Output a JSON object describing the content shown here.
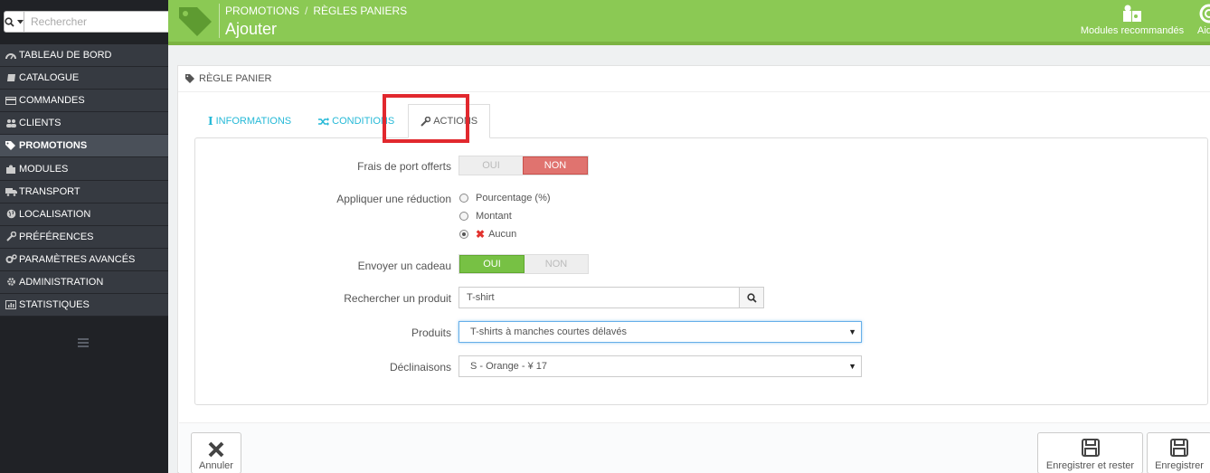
{
  "search": {
    "placeholder": "Rechercher"
  },
  "sidebar": {
    "items": [
      {
        "label": "TABLEAU DE BORD",
        "icon": "dashboard-icon"
      },
      {
        "label": "CATALOGUE",
        "icon": "book-icon"
      },
      {
        "label": "COMMANDES",
        "icon": "credit-card-icon"
      },
      {
        "label": "CLIENTS",
        "icon": "users-icon"
      },
      {
        "label": "PROMOTIONS",
        "icon": "tags-icon",
        "active": true
      },
      {
        "label": "MODULES",
        "icon": "puzzle-icon"
      },
      {
        "label": "TRANSPORT",
        "icon": "truck-icon"
      },
      {
        "label": "LOCALISATION",
        "icon": "globe-icon"
      },
      {
        "label": "PRÉFÉRENCES",
        "icon": "wrench-icon"
      },
      {
        "label": "PARAMÈTRES AVANCÉS",
        "icon": "cogs-icon"
      },
      {
        "label": "ADMINISTRATION",
        "icon": "gear-icon"
      },
      {
        "label": "STATISTIQUES",
        "icon": "bar-chart-icon"
      }
    ]
  },
  "header": {
    "breadcrumb_1": "PROMOTIONS",
    "breadcrumb_sep": "/",
    "breadcrumb_2": "RÈGLES PANIERS",
    "title": "Ajouter",
    "modules_label": "Modules recommandés",
    "help_label": "Aide"
  },
  "panel": {
    "heading": "RÈGLE PANIER",
    "tabs": [
      {
        "label": "INFORMATIONS",
        "icon": "info-icon"
      },
      {
        "label": "CONDITIONS",
        "icon": "shuffle-icon"
      },
      {
        "label": "ACTIONS",
        "icon": "wrench-icon",
        "active": true
      }
    ]
  },
  "form": {
    "free_shipping_label": "Frais de port offerts",
    "free_shipping_yes": "OUI",
    "free_shipping_no": "NON",
    "free_shipping_value": "NON",
    "discount_label": "Appliquer une réduction",
    "discount_options": [
      "Pourcentage (%)",
      "Montant",
      "Aucun"
    ],
    "discount_selected": "Aucun",
    "gift_label": "Envoyer un cadeau",
    "gift_yes": "OUI",
    "gift_no": "NON",
    "gift_value": "OUI",
    "search_product_label": "Rechercher un produit",
    "search_product_value": "T-shirt",
    "products_label": "Produits",
    "products_value": "T-shirts à manches courtes délavés",
    "variants_label": "Déclinaisons",
    "variants_value": "S - Orange - ¥ 17"
  },
  "footer": {
    "cancel_label": "Annuler",
    "save_stay_label": "Enregistrer et rester",
    "save_label": "Enregistrer"
  },
  "colors": {
    "header_green": "#8bc954",
    "sidebar_dark": "#202226",
    "toggle_red": "#e0736f",
    "toggle_green": "#77c144",
    "link_blue": "#25b9d7",
    "highlight_red": "#e1282e"
  }
}
